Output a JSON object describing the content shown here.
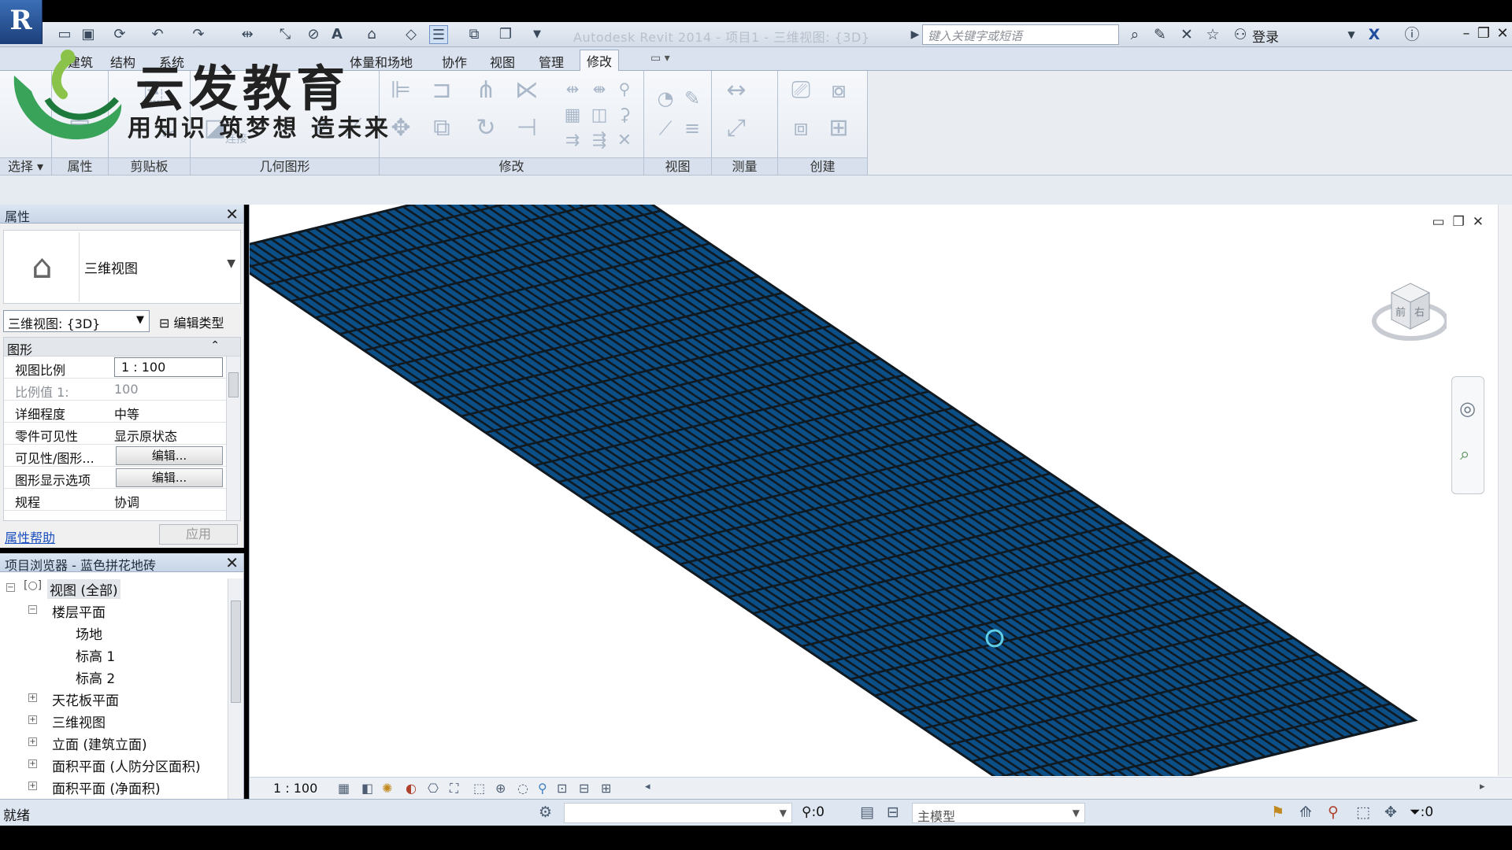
{
  "app": {
    "title": "Autodesk Revit 2014 -    项目1 - 三维视图: {3D}",
    "search_placeholder": "键入关键字或短语",
    "login_label": "登录",
    "logo_text": "云发教育",
    "logo_slogan": "用知识 筑梦想 造未来"
  },
  "tabs": [
    {
      "label": "建筑"
    },
    {
      "label": "结构"
    },
    {
      "label": "系统"
    },
    {
      "label": "体量和场地"
    },
    {
      "label": "协作"
    },
    {
      "label": "视图"
    },
    {
      "label": "管理"
    },
    {
      "label": "修改"
    }
  ],
  "active_tab": "修改",
  "ribbon": {
    "panels": [
      {
        "label": "选择 ▾"
      },
      {
        "label": "属性"
      },
      {
        "label": "剪贴板"
      },
      {
        "label": "几何图形"
      },
      {
        "label": "修改"
      },
      {
        "label": "视图"
      },
      {
        "label": "测量"
      },
      {
        "label": "创建"
      }
    ],
    "join_label": "连接"
  },
  "properties": {
    "title": "属性",
    "type_name": "三维视图",
    "instance_selector": "三维视图: {3D}",
    "edit_type_label": "编辑类型",
    "group": "图形",
    "rows": [
      {
        "key": "视图比例",
        "value": "1 : 100"
      },
      {
        "key": "比例值 1:",
        "value": "100"
      },
      {
        "key": "详细程度",
        "value": "中等"
      },
      {
        "key": "零件可见性",
        "value": "显示原状态"
      },
      {
        "key": "可见性/图形...",
        "value": "编辑..."
      },
      {
        "key": "图形显示选项",
        "value": "编辑..."
      },
      {
        "key": "规程",
        "value": "协调"
      }
    ],
    "help_link": "属性帮助",
    "apply_label": "应用"
  },
  "browser": {
    "title": "项目浏览器 - 蓝色拼花地砖",
    "nodes": [
      {
        "label": "视图 (全部)"
      },
      {
        "label": "楼层平面"
      },
      {
        "label": "场地"
      },
      {
        "label": "标高 1"
      },
      {
        "label": "标高 2"
      },
      {
        "label": "天花板平面"
      },
      {
        "label": "三维视图"
      },
      {
        "label": "立面 (建筑立面)"
      },
      {
        "label": "面积平面 (人防分区面积)"
      },
      {
        "label": "面积平面 (净面积)"
      }
    ]
  },
  "view": {
    "scale_label": "1 : 100",
    "viewcube_front": "前",
    "viewcube_right": "右",
    "floor_color": "#0b4f86",
    "grid_line_color": "#101820"
  },
  "status": {
    "text": "就绪",
    "selection_count": ":0",
    "model_selector": "主模型",
    "filter_count": ":0"
  },
  "colors": {
    "titlebar": "#d3dce8",
    "ribbon": "#eef2f7",
    "accent": "#1a4fbf"
  }
}
